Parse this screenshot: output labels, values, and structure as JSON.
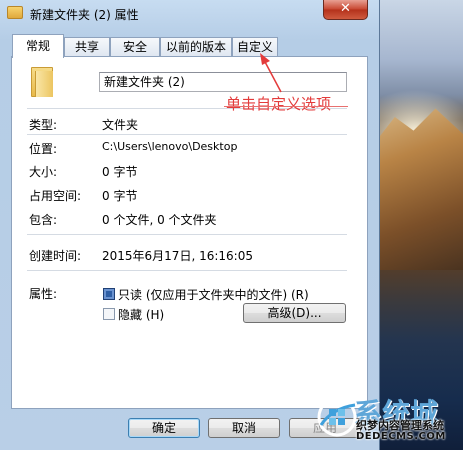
{
  "window": {
    "title": "新建文件夹 (2) 属性",
    "close_label": "✕"
  },
  "tabs": [
    {
      "label": "常规",
      "active": true
    },
    {
      "label": "共享",
      "active": false
    },
    {
      "label": "安全",
      "active": false
    },
    {
      "label": "以前的版本",
      "active": false
    },
    {
      "label": "自定义",
      "active": false
    }
  ],
  "general": {
    "folder_name": "新建文件夹 (2)",
    "type_label": "类型:",
    "type_value": "文件夹",
    "location_label": "位置:",
    "location_value": "C:\\Users\\lenovo\\Desktop",
    "size_label": "大小:",
    "size_value": "0 字节",
    "size_on_disk_label": "占用空间:",
    "size_on_disk_value": "0 字节",
    "contains_label": "包含:",
    "contains_value": "0 个文件, 0 个文件夹",
    "created_label": "创建时间:",
    "created_value": "2015年6月17日, 16:16:05",
    "attributes_label": "属性:",
    "readonly_label": "只读 (仅应用于文件夹中的文件) (R)",
    "readonly_checked": true,
    "hidden_label": "隐藏 (H)",
    "hidden_checked": false,
    "advanced_label": "高级(D)..."
  },
  "footer": {
    "ok_label": "确定",
    "cancel_label": "取消",
    "apply_label": "应用"
  },
  "annotation": {
    "text": "单击自定义选项",
    "color": "#e33b3b"
  },
  "watermark": {
    "big": "系统城",
    "sub": "织梦内容管理系统",
    "url": "DEDECMS.COM"
  }
}
